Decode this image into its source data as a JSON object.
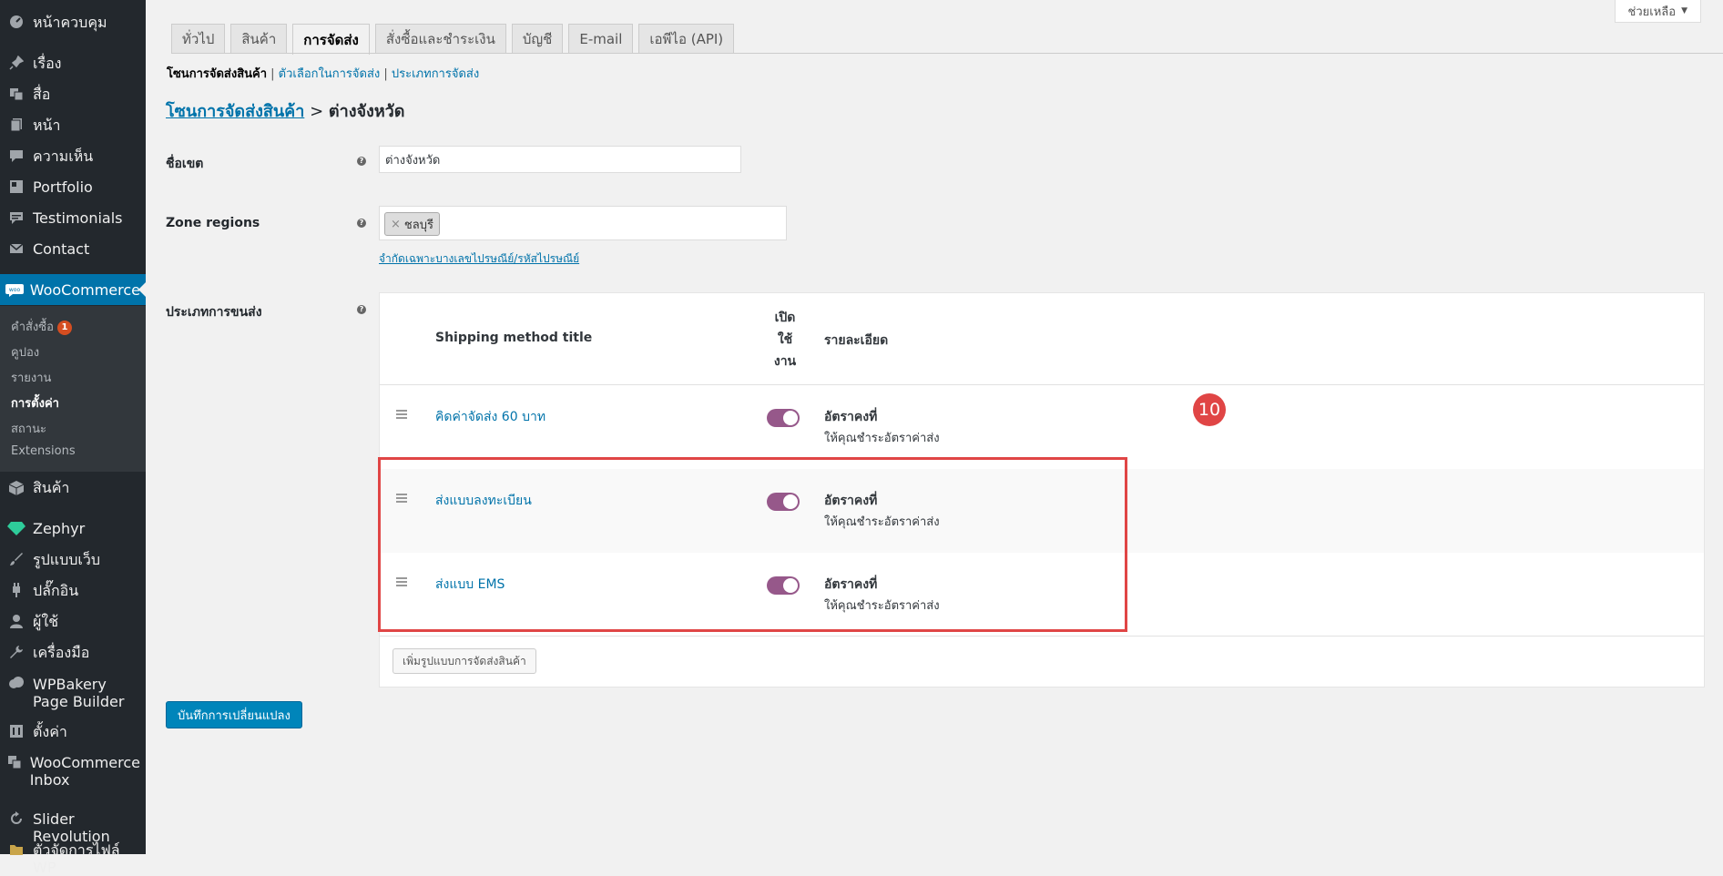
{
  "sidebar": {
    "items": [
      {
        "label": "หน้าควบคุม",
        "icon": "dashboard-icon"
      },
      {
        "label": "เรื่อง",
        "icon": "pin-icon"
      },
      {
        "label": "สื่อ",
        "icon": "media-icon"
      },
      {
        "label": "หน้า",
        "icon": "page-icon"
      },
      {
        "label": "ความเห็น",
        "icon": "comment-icon"
      },
      {
        "label": "Portfolio",
        "icon": "portfolio-icon"
      },
      {
        "label": "Testimonials",
        "icon": "testimonial-icon"
      },
      {
        "label": "Contact",
        "icon": "mail-icon"
      },
      {
        "label": "WooCommerce",
        "icon": "woo-icon"
      },
      {
        "label": "สินค้า",
        "icon": "box-icon"
      },
      {
        "label": "Zephyr",
        "icon": "diamond-icon"
      },
      {
        "label": "รูปแบบเว็บ",
        "icon": "brush-icon"
      },
      {
        "label": "ปลั๊กอิน",
        "icon": "plugin-icon"
      },
      {
        "label": "ผู้ใช้",
        "icon": "user-icon"
      },
      {
        "label": "เครื่องมือ",
        "icon": "wrench-icon"
      },
      {
        "label": "WPBakery Page Builder",
        "icon": "cloud-icon"
      },
      {
        "label": "ตั้งค่า",
        "icon": "settings-icon"
      },
      {
        "label": "WooCommerce Inbox",
        "icon": "inbox-icon"
      },
      {
        "label": "Slider Revolution",
        "icon": "refresh-icon"
      },
      {
        "label": "ตัวจัดการไฟล์ WP",
        "icon": "folder-icon"
      }
    ],
    "submenu": [
      {
        "label": "คำสั่งซื้อ",
        "badge": "1"
      },
      {
        "label": "คูปอง"
      },
      {
        "label": "รายงาน"
      },
      {
        "label": "การตั้งค่า",
        "current": true
      },
      {
        "label": "สถานะ"
      },
      {
        "label": "Extensions"
      }
    ]
  },
  "help_tab": {
    "label": "ช่วยเหลือ"
  },
  "tabs": [
    "ทั่วไป",
    "สินค้า",
    "การจัดส่ง",
    "สั่งซื้อและชำระเงิน",
    "บัญชี",
    "E-mail",
    "เอพีไอ (API)"
  ],
  "subsubsub": {
    "current": "โซนการจัดส่งสินค้า",
    "link1": "ตัวเลือกในการจัดส่ง",
    "link2": "ประเภทการจัดส่ง"
  },
  "heading": {
    "link": "โซนการจัดส่งสินค้า",
    "separator": ">",
    "current": "ต่างจังหวัด"
  },
  "form": {
    "zone_name_label": "ชื่อเขต",
    "zone_name_value": "ต่างจังหวัด",
    "zone_regions_label": "Zone regions",
    "region_chip": "ชลบุรี",
    "postcode_link": "จำกัดเฉพาะบางเลขไปรษณีย์/รหัสไปรษณีย์",
    "methods_label": "ประเภทการขนส่ง"
  },
  "table": {
    "col_title": "Shipping method title",
    "col_enabled": [
      "เปิด",
      "ใช้",
      "งาน"
    ],
    "col_desc": "รายละเอียด",
    "rows": [
      {
        "title": "คิดค่าจัดส่ง 60 บาท",
        "enabled": true,
        "desc_title": "อัตราคงที่",
        "desc_sub": "ให้คุณชำระอัตราค่าส่ง"
      },
      {
        "title": "ส่งแบบลงทะเบียน",
        "enabled": true,
        "desc_title": "อัตราคงที่",
        "desc_sub": "ให้คุณชำระอัตราค่าส่ง"
      },
      {
        "title": "ส่งแบบ EMS",
        "enabled": true,
        "desc_title": "อัตราคงที่",
        "desc_sub": "ให้คุณชำระอัตราค่าส่ง"
      }
    ],
    "add_button": "เพิ่มรูปแบบการจัดส่งสินค้า"
  },
  "save_button": "บันทึกการเปลี่ยนแปลง",
  "step_badge": "10",
  "colors": {
    "sidebar": "#23282d",
    "accent": "#0073aa",
    "toggle": "#96588a",
    "highlight": "#e04545"
  }
}
